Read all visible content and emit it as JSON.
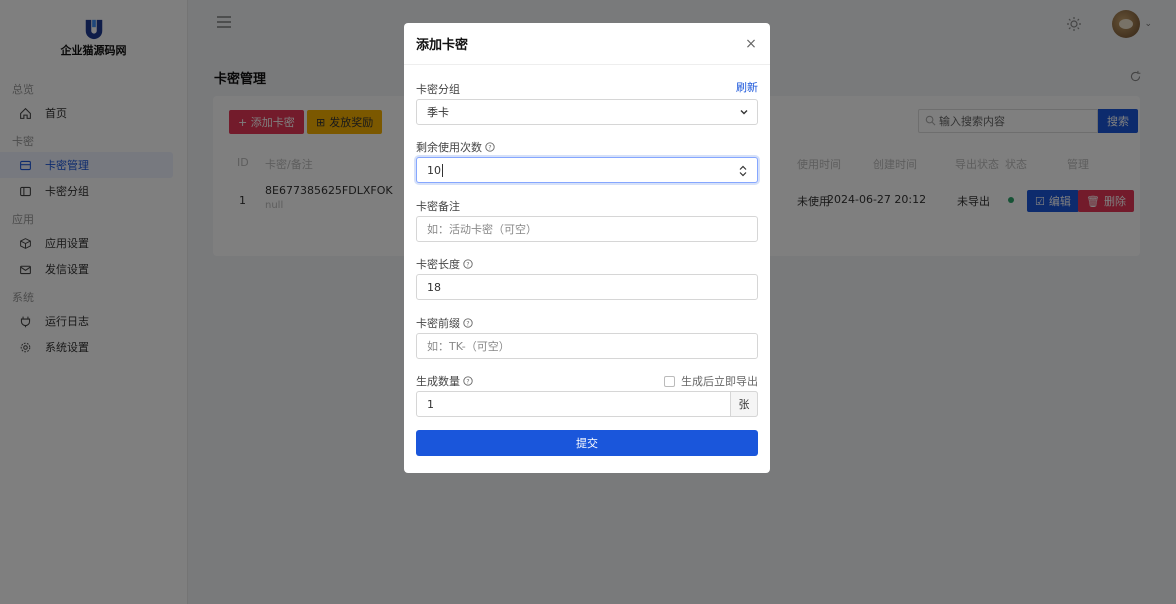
{
  "brand": {
    "name": "企业猫源码网"
  },
  "sidebar": {
    "sections": [
      {
        "title": "总览",
        "items": [
          {
            "label": "首页",
            "icon": "home-icon"
          }
        ]
      },
      {
        "title": "卡密",
        "items": [
          {
            "label": "卡密管理",
            "icon": "card-icon",
            "active": true
          },
          {
            "label": "卡密分组",
            "icon": "folder-icon"
          }
        ]
      },
      {
        "title": "应用",
        "items": [
          {
            "label": "应用设置",
            "icon": "box-icon"
          },
          {
            "label": "发信设置",
            "icon": "mail-icon"
          }
        ]
      },
      {
        "title": "系统",
        "items": [
          {
            "label": "运行日志",
            "icon": "plug-icon"
          },
          {
            "label": "系统设置",
            "icon": "gear-icon"
          }
        ]
      }
    ]
  },
  "page": {
    "title": "卡密管理"
  },
  "toolbar": {
    "add_label": "+ 添加卡密",
    "issue_label": "发放奖励",
    "search_placeholder": "输入搜索内容",
    "search_label": "搜索"
  },
  "table": {
    "headers": [
      "ID",
      "卡密/备注",
      "使用时间",
      "创建时间",
      "导出状态",
      "状态",
      "管理"
    ],
    "rows": [
      {
        "id": "1",
        "card": "8E677385625FDLXFOK",
        "remark": "null",
        "use_time": "未使用",
        "created": "2024-06-27 20:12",
        "export": "未导出",
        "edit": "编辑",
        "delete": "删除"
      }
    ]
  },
  "modal": {
    "title": "添加卡密",
    "group_label": "卡密分组",
    "refresh_label": "刷新",
    "group_value": "季卡",
    "uses_label": "剩余使用次数",
    "uses_value": "10",
    "remark_label": "卡密备注",
    "remark_placeholder": "如：活动卡密（可空）",
    "length_label": "卡密长度",
    "length_value": "18",
    "prefix_label": "卡密前缀",
    "prefix_placeholder": "如：TK-（可空）",
    "qty_label": "生成数量",
    "qty_value": "1",
    "qty_unit": "张",
    "export_check_label": "生成后立即导出",
    "submit_label": "提交"
  },
  "colors": {
    "primary": "#1a56db",
    "danger": "#e63757",
    "warning": "#f6b100",
    "success": "#2ca56b"
  }
}
